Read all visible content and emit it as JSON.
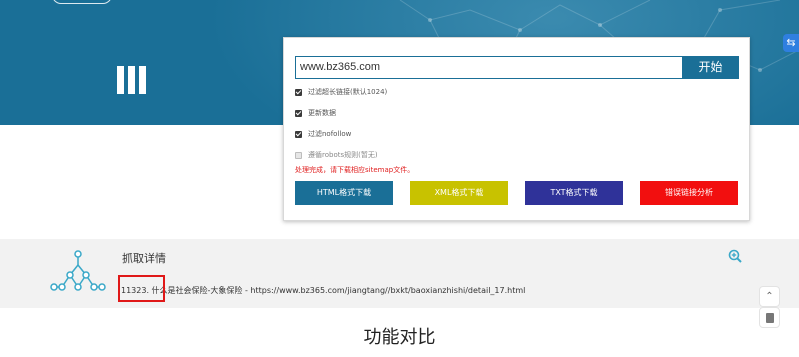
{
  "panel": {
    "url_value": "www.bz365.com",
    "start_label": "开始",
    "options": [
      {
        "label": "过滤超长链接(默认1024)",
        "checked": true
      },
      {
        "label": "更新数据",
        "checked": true
      },
      {
        "label": "过滤nofollow",
        "checked": true
      },
      {
        "label": "遵循robots规则(暂无)",
        "checked": false
      }
    ],
    "status": "处理完成，请下载相应sitemap文件。",
    "actions": {
      "html": "HTML格式下载",
      "xml": "XML格式下载",
      "txt": "TXT格式下载",
      "errors": "错误链接分析"
    }
  },
  "details": {
    "title": "抓取详情",
    "line": "11323. 什么是社会保险-大象保险 - https://www.bz365.com/jiangtang//bxkt/baoxianzhishi/detail_17.html"
  },
  "compare_title": "功能对比",
  "colors": {
    "brand_blue": "#1a6f97",
    "xml_yellow": "#c8c200",
    "txt_navy": "#2f3299",
    "error_red": "#f20f0f",
    "highlight_red": "#e01818"
  },
  "icons": [
    "bars-logo-icon",
    "tree-network-icon",
    "zoom-in-icon",
    "arrow-up-icon",
    "document-icon",
    "side-widget-icon"
  ]
}
